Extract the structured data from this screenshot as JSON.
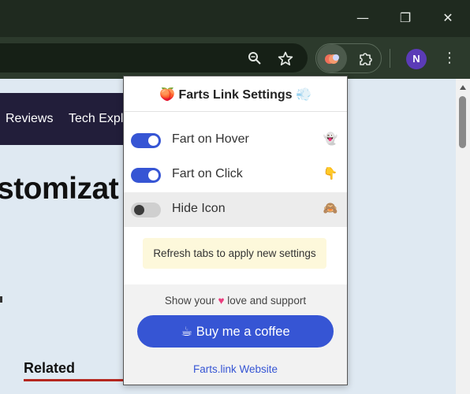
{
  "browser": {
    "controls": {
      "minimize": "—",
      "maximize": "❐",
      "close": "✕"
    },
    "toolbar": {
      "zoom_icon": "zoom-icon",
      "bookmark_icon": "star-icon",
      "extensions_icon": "puzzle-icon",
      "profile_initial": "N",
      "menu_icon": "⋮"
    }
  },
  "page": {
    "nav_items": [
      "Reviews",
      "Tech Expla"
    ],
    "heading": "stomizat",
    "related": "Related"
  },
  "popup": {
    "title_icon": "🍑",
    "title": "Farts Link Settings",
    "title_badge": "💨",
    "settings": [
      {
        "label": "Fart on Hover",
        "enabled": true,
        "icon": "👻"
      },
      {
        "label": "Fart on Click",
        "enabled": true,
        "icon": "👇"
      },
      {
        "label": "Hide Icon",
        "enabled": false,
        "icon": "🙈"
      }
    ],
    "notice": "Refresh tabs to apply new settings",
    "support": {
      "prefix": "Show your",
      "heart": "♥",
      "suffix": "love and support",
      "button_icon": "☕",
      "button_label": "Buy me a coffee",
      "link": "Farts.link Website"
    }
  },
  "colors": {
    "accent": "#3655d4",
    "titlebar": "#1f2a1f",
    "toolbar": "#2c3a2c",
    "notice_bg": "#fdf8db",
    "heart": "#ea3e7e"
  }
}
